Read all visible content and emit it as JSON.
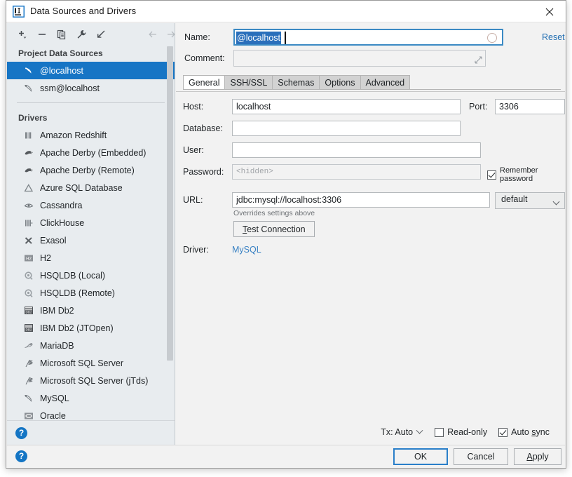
{
  "window": {
    "title": "Data Sources and Drivers",
    "app_icon": "intellij-idea-icon",
    "close_icon": "close-icon"
  },
  "left_panel": {
    "toolbar": [
      {
        "name": "add-button",
        "icon": "plus-icon"
      },
      {
        "name": "remove-button",
        "icon": "minus-icon"
      },
      {
        "name": "copy-button",
        "icon": "copy-icon"
      },
      {
        "name": "properties-button",
        "icon": "wrench-icon"
      },
      {
        "name": "import-button",
        "icon": "import-arrow-icon"
      },
      {
        "name": "back-button",
        "icon": "arrow-left-icon"
      },
      {
        "name": "forward-button",
        "icon": "arrow-right-icon"
      }
    ],
    "project_sources_header": "Project Data Sources",
    "project_sources": [
      {
        "label": "@localhost",
        "icon": "mysql-dolphin-icon",
        "selected": true
      },
      {
        "label": "ssm@localhost",
        "icon": "mysql-dolphin-icon",
        "selected": false
      }
    ],
    "drivers_header": "Drivers",
    "drivers": [
      {
        "label": "Amazon Redshift",
        "icon": "redshift-icon"
      },
      {
        "label": "Apache Derby (Embedded)",
        "icon": "derby-icon"
      },
      {
        "label": "Apache Derby (Remote)",
        "icon": "derby-icon"
      },
      {
        "label": "Azure SQL Database",
        "icon": "azure-icon"
      },
      {
        "label": "Cassandra",
        "icon": "cassandra-eye-icon"
      },
      {
        "label": "ClickHouse",
        "icon": "clickhouse-icon"
      },
      {
        "label": "Exasol",
        "icon": "exasol-x-icon"
      },
      {
        "label": "H2",
        "icon": "h2-icon"
      },
      {
        "label": "HSQLDB (Local)",
        "icon": "hsqldb-icon"
      },
      {
        "label": "HSQLDB (Remote)",
        "icon": "hsqldb-icon"
      },
      {
        "label": "IBM Db2",
        "icon": "db2-icon"
      },
      {
        "label": "IBM Db2 (JTOpen)",
        "icon": "db2-icon"
      },
      {
        "label": "MariaDB",
        "icon": "mariadb-seal-icon"
      },
      {
        "label": "Microsoft SQL Server",
        "icon": "mssql-icon"
      },
      {
        "label": "Microsoft SQL Server (jTds)",
        "icon": "mssql-icon"
      },
      {
        "label": "MySQL",
        "icon": "mysql-dolphin-icon"
      },
      {
        "label": "Oracle",
        "icon": "oracle-icon"
      }
    ],
    "help_icon": "help-icon"
  },
  "form": {
    "name_label": "Name:",
    "name_value": "@localhost",
    "name_spinner_icon": "idle-circle-icon",
    "reset_label": "Reset",
    "comment_label": "Comment:",
    "comment_value": "",
    "comment_placeholder": "",
    "comment_resize_icon": "expand-icon"
  },
  "tabs": [
    {
      "label": "General",
      "active": true
    },
    {
      "label": "SSH/SSL",
      "active": false
    },
    {
      "label": "Schemas",
      "active": false
    },
    {
      "label": "Options",
      "active": false
    },
    {
      "label": "Advanced",
      "active": false
    }
  ],
  "general": {
    "host_label": "Host:",
    "host_value": "localhost",
    "port_label": "Port:",
    "port_value": "3306",
    "database_label": "Database:",
    "database_value": "",
    "user_label": "User:",
    "user_value": "",
    "password_label": "Password:",
    "password_placeholder": "<hidden>",
    "password_value": "",
    "remember_password_label": "Remember password",
    "remember_password_checked": true,
    "url_label": "URL:",
    "url_value": "jdbc:mysql://localhost:3306",
    "url_hint": "Overrides settings above",
    "url_mode": "default",
    "url_mode_caret_icon": "chevron-down-icon",
    "test_connection_label": "Test Connection",
    "driver_label": "Driver:",
    "driver_value": "MySQL"
  },
  "bottom_options": {
    "tx_label": "Tx: Auto",
    "tx_caret_icon": "chevron-down-icon",
    "read_only_label": "Read-only",
    "read_only_checked": false,
    "auto_sync_label": "Auto sync",
    "auto_sync_checked": true
  },
  "button_bar": {
    "help_icon": "help-icon",
    "ok_label": "OK",
    "cancel_label": "Cancel",
    "apply_label": "Apply"
  },
  "colors": {
    "accent_blue": "#1675c5",
    "link_blue": "#2470b3",
    "selection_blue": "#2a6fbb",
    "sidebar_bg": "#e8ecef",
    "panel_bg": "#f2f2f2"
  }
}
